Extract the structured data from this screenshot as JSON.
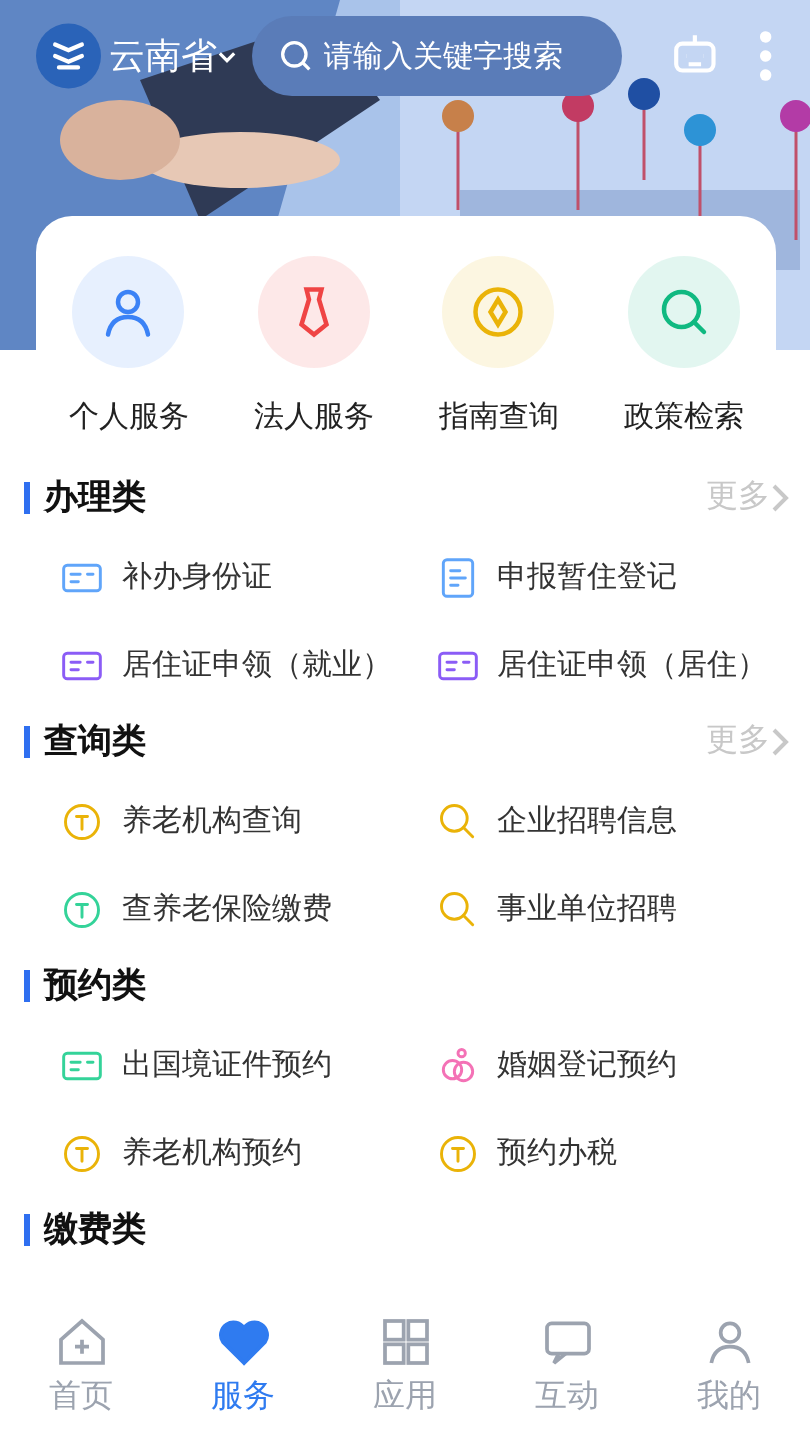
{
  "header": {
    "region": "云南省",
    "search": {
      "placeholder": "请输入关键字搜索"
    }
  },
  "quick": [
    {
      "label": "个人服务",
      "kind": "person",
      "color": "#3b82f6"
    },
    {
      "label": "法人服务",
      "kind": "tie",
      "color": "#ef4444"
    },
    {
      "label": "指南查询",
      "kind": "compass",
      "color": "#eab308"
    },
    {
      "label": "政策检索",
      "kind": "search",
      "color": "#10b981"
    }
  ],
  "sections": [
    {
      "title": "办理类",
      "more": "更多",
      "items": [
        {
          "label": "补办身份证",
          "kind": "card",
          "color": "#60a5fa"
        },
        {
          "label": "申报暂住登记",
          "kind": "doc",
          "color": "#60a5fa"
        },
        {
          "label": "居住证申领（就业）",
          "kind": "card",
          "color": "#8b5cf6"
        },
        {
          "label": "居住证申领（居住）",
          "kind": "card",
          "color": "#8b5cf6"
        }
      ]
    },
    {
      "title": "查询类",
      "more": "更多",
      "items": [
        {
          "label": "养老机构查询",
          "kind": "coin",
          "color": "#eab308"
        },
        {
          "label": "企业招聘信息",
          "kind": "magnifier",
          "color": "#eab308"
        },
        {
          "label": "查养老保险缴费",
          "kind": "coin",
          "color": "#34d399"
        },
        {
          "label": "事业单位招聘",
          "kind": "magnifier",
          "color": "#eab308"
        }
      ]
    },
    {
      "title": "预约类",
      "items": [
        {
          "label": "出国境证件预约",
          "kind": "card",
          "color": "#34d399"
        },
        {
          "label": "婚姻登记预约",
          "kind": "rings",
          "color": "#f472b6"
        },
        {
          "label": "养老机构预约",
          "kind": "coin",
          "color": "#eab308"
        },
        {
          "label": "预约办税",
          "kind": "coin",
          "color": "#eab308"
        }
      ]
    },
    {
      "title": "缴费类"
    }
  ],
  "nav": [
    {
      "label": "首页",
      "kind": "home",
      "selected": false
    },
    {
      "label": "服务",
      "kind": "heart",
      "selected": true
    },
    {
      "label": "应用",
      "kind": "grid",
      "selected": false
    },
    {
      "label": "互动",
      "kind": "chat",
      "selected": false
    },
    {
      "label": "我的",
      "kind": "user",
      "selected": false
    }
  ]
}
